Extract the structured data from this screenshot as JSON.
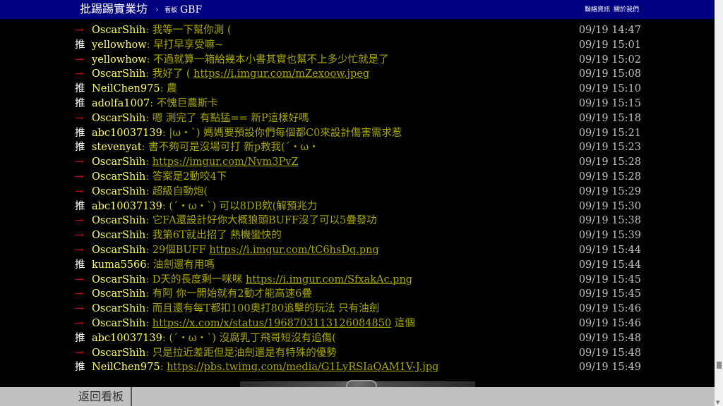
{
  "header": {
    "site_title": "批踢踢實業坊",
    "breadcrumb_sep": "›",
    "board_label": "看板",
    "board_name": "GBF",
    "links": [
      "聯絡資訊",
      "關於我們"
    ]
  },
  "comments": [
    {
      "tag": "→",
      "kind": "arrow",
      "user": "OscarShih",
      "text": "我等一下幫你測 (",
      "time": "09/19 14:47"
    },
    {
      "tag": "推",
      "kind": "push",
      "user": "yellowhow",
      "text": "早打早享受嘛~",
      "time": "09/19 15:01"
    },
    {
      "tag": "→",
      "kind": "arrow",
      "user": "yellowhow",
      "text": "不過就算一箱給幾本小書其實也幫不上多少忙就是了",
      "time": "09/19 15:02"
    },
    {
      "tag": "→",
      "kind": "arrow",
      "user": "OscarShih",
      "text": "我好了 ( ",
      "link": "https://i.imgur.com/mZexoow.jpeg",
      "time": "09/19 15:08"
    },
    {
      "tag": "推",
      "kind": "push",
      "user": "NeilChen975",
      "text": "農",
      "time": "09/19 15:10"
    },
    {
      "tag": "推",
      "kind": "push",
      "user": "adolfa1007",
      "text": "不愧巨農斯卡",
      "time": "09/19 15:15"
    },
    {
      "tag": "→",
      "kind": "arrow",
      "user": "OscarShih",
      "text": "嗯 測完了 有點猛== 新P這樣好嗎",
      "time": "09/19 15:18"
    },
    {
      "tag": "推",
      "kind": "push",
      "user": "abc10037139",
      "text": "|ω・`) 媽媽要預設你們每個都C0來設計傷害需求惹",
      "time": "09/19 15:21"
    },
    {
      "tag": "推",
      "kind": "push",
      "user": "stevenyat",
      "text": "書不夠可是沒場可打 新p救我(´・ω・",
      "time": "09/19 15:23"
    },
    {
      "tag": "→",
      "kind": "arrow",
      "user": "OscarShih",
      "text": "",
      "link": "https://imgur.com/Nvm3PvZ",
      "time": "09/19 15:28"
    },
    {
      "tag": "→",
      "kind": "arrow",
      "user": "OscarShih",
      "text": "答案是2動咬4下",
      "time": "09/19 15:28"
    },
    {
      "tag": "→",
      "kind": "arrow",
      "user": "OscarShih",
      "text": "超級自動炮(",
      "time": "09/19 15:29"
    },
    {
      "tag": "推",
      "kind": "push",
      "user": "abc10037139",
      "text": "(´・ω・`) 可以8DB欸(解預兆力",
      "time": "09/19 15:30"
    },
    {
      "tag": "→",
      "kind": "arrow",
      "user": "OscarShih",
      "text": "它FA還設計好你大概狼頭BUFF沒了可以5疊發功",
      "time": "09/19 15:38"
    },
    {
      "tag": "→",
      "kind": "arrow",
      "user": "OscarShih",
      "text": "我第6T就出招了 熱機蠻快的",
      "time": "09/19 15:39"
    },
    {
      "tag": "→",
      "kind": "arrow",
      "user": "OscarShih",
      "text": "29個BUFF ",
      "link": "https://i.imgur.com/tC6hsDq.png",
      "time": "09/19 15:44"
    },
    {
      "tag": "推",
      "kind": "push",
      "user": "kuma5566",
      "text": "油劍還有用嗎",
      "time": "09/19 15:44"
    },
    {
      "tag": "→",
      "kind": "arrow",
      "user": "OscarShih",
      "text": "D天的長度剩一咪咪 ",
      "link": "https://i.imgur.com/SfxakAc.png",
      "time": "09/19 15:45"
    },
    {
      "tag": "→",
      "kind": "arrow",
      "user": "OscarShih",
      "text": "有阿 你一開始就有2動才能高速6疊",
      "time": "09/19 15:45"
    },
    {
      "tag": "→",
      "kind": "arrow",
      "user": "OscarShih",
      "text": "而且還有每T都扣100奧打80追擊的玩法 只有油劍",
      "time": "09/19 15:46"
    },
    {
      "tag": "→",
      "kind": "arrow",
      "user": "OscarShih",
      "text": "",
      "link": "https://x.com/x/status/1968703113126084850",
      "after": " 這個",
      "time": "09/19 15:46"
    },
    {
      "tag": "推",
      "kind": "push",
      "user": "abc10037139",
      "text": "(´・ω・`) 沒腐乳丁飛哥短沒有追傷(",
      "time": "09/19 15:48"
    },
    {
      "tag": "→",
      "kind": "arrow",
      "user": "OscarShih",
      "text": "只是拉近差距但是油劍還是有特殊的優勢",
      "time": "09/19 15:48"
    },
    {
      "tag": "推",
      "kind": "push",
      "user": "NeilChen975",
      "text": "",
      "link": "https://pbs.twimg.com/media/G1LyRSIaQAM1V-J.jpg",
      "time": "09/19 15:49"
    }
  ],
  "footer": {
    "back_label": "返回看板"
  },
  "colors": {
    "nav_bg": "#000080",
    "arrow": "#e00000",
    "userid": "#ffff60",
    "content": "#a8a800",
    "date": "#c0c0c0"
  }
}
